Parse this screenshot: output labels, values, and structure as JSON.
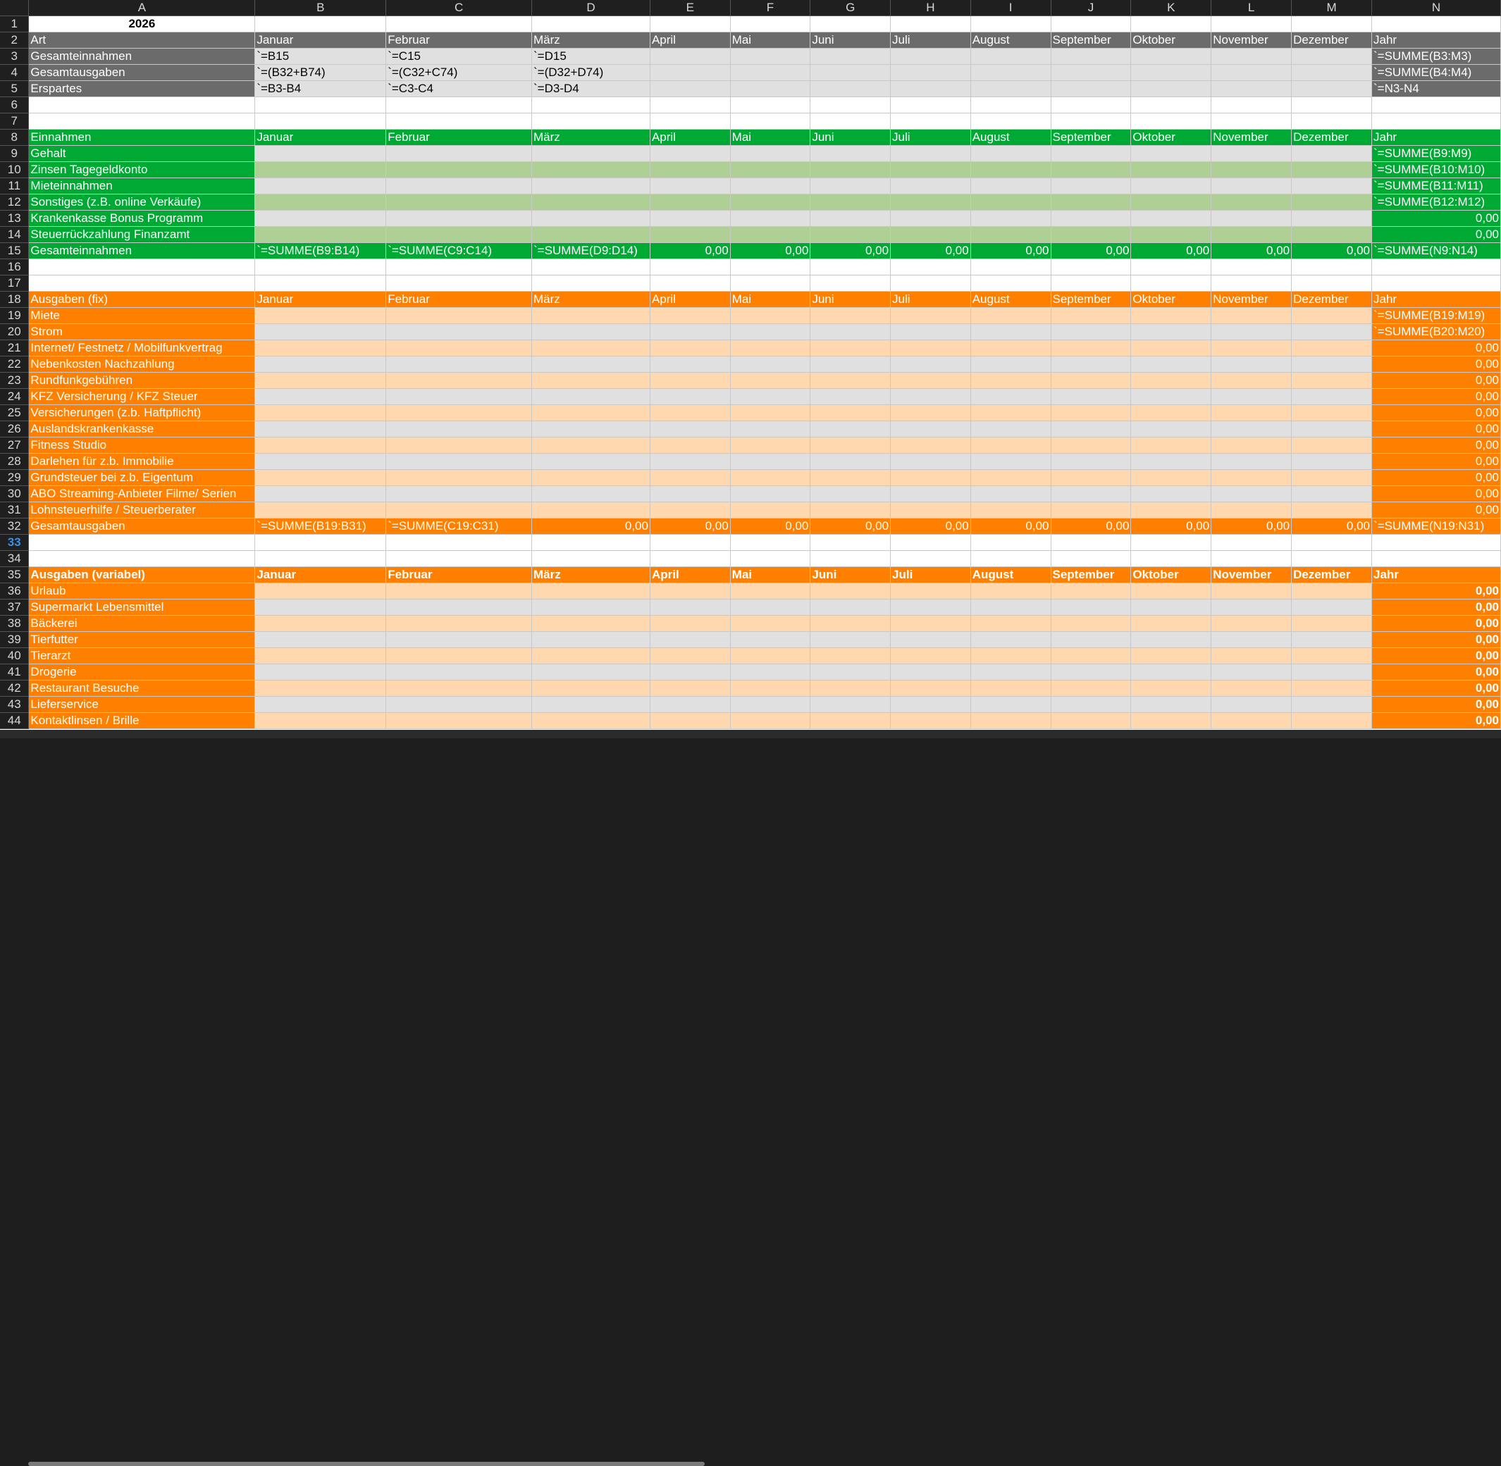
{
  "columns": [
    "A",
    "B",
    "C",
    "D",
    "E",
    "F",
    "G",
    "H",
    "I",
    "J",
    "K",
    "L",
    "M",
    "N"
  ],
  "colors": {
    "gray_dark": "#6b6b6b",
    "gray_light": "#e0e0e0",
    "green": "#00a933",
    "green_light": "#afd095",
    "orange": "#ff8000",
    "orange_light": "#ffd8b0",
    "white": "#ffffff",
    "text_white": "#ffffff",
    "text_dark": "#000000"
  },
  "rows": [
    {
      "n": "1",
      "style": "title",
      "cells": [
        "2026",
        "",
        "",
        "",
        "",
        "",
        "",
        "",
        "",
        "",
        "",
        "",
        "",
        ""
      ]
    },
    {
      "n": "2",
      "style": "gray-header",
      "cells": [
        "Art",
        "Januar",
        "Februar",
        "März",
        "April",
        "Mai",
        "Juni",
        "Juli",
        "August",
        "September",
        "Oktober",
        "November",
        "Dezember",
        "Jahr"
      ]
    },
    {
      "n": "3",
      "style": "gray-row",
      "cells": [
        "Gesamteinnahmen",
        "`=B15",
        "`=C15",
        "`=D15",
        "",
        "",
        "",
        "",
        "",
        "",
        "",
        "",
        "",
        "`=SUMME(B3:M3)"
      ]
    },
    {
      "n": "4",
      "style": "gray-row",
      "cells": [
        "Gesamtausgaben",
        "`=(B32+B74)",
        "`=(C32+C74)",
        "`=(D32+D74)",
        "",
        "",
        "",
        "",
        "",
        "",
        "",
        "",
        "",
        "`=SUMME(B4:M4)"
      ]
    },
    {
      "n": "5",
      "style": "gray-row",
      "cells": [
        "Erspartes",
        "`=B3-B4",
        "`=C3-C4",
        "`=D3-D4",
        "",
        "",
        "",
        "",
        "",
        "",
        "",
        "",
        "",
        "`=N3-N4"
      ]
    },
    {
      "n": "6",
      "style": "empty",
      "cells": [
        "",
        "",
        "",
        "",
        "",
        "",
        "",
        "",
        "",
        "",
        "",
        "",
        "",
        ""
      ]
    },
    {
      "n": "7",
      "style": "empty",
      "cells": [
        "",
        "",
        "",
        "",
        "",
        "",
        "",
        "",
        "",
        "",
        "",
        "",
        "",
        ""
      ]
    },
    {
      "n": "8",
      "style": "green-header",
      "cells": [
        "Einnahmen",
        "Januar",
        "Februar",
        "März",
        "April",
        "Mai",
        "Juni",
        "Juli",
        "August",
        "September",
        "Oktober",
        "November",
        "Dezember",
        "Jahr"
      ]
    },
    {
      "n": "9",
      "style": "green-a",
      "cells": [
        "Gehalt",
        "",
        "",
        "",
        "",
        "",
        "",
        "",
        "",
        "",
        "",
        "",
        "",
        "`=SUMME(B9:M9)"
      ]
    },
    {
      "n": "10",
      "style": "green-b",
      "cells": [
        "Zinsen Tagegeldkonto",
        "",
        "",
        "",
        "",
        "",
        "",
        "",
        "",
        "",
        "",
        "",
        "",
        "`=SUMME(B10:M10)"
      ]
    },
    {
      "n": "11",
      "style": "green-a",
      "cells": [
        "Mieteinnahmen",
        "",
        "",
        "",
        "",
        "",
        "",
        "",
        "",
        "",
        "",
        "",
        "",
        "`=SUMME(B11:M11)"
      ]
    },
    {
      "n": "12",
      "style": "green-b",
      "cells": [
        "Sonstiges (z.B. online Verkäufe)",
        "",
        "",
        "",
        "",
        "",
        "",
        "",
        "",
        "",
        "",
        "",
        "",
        "`=SUMME(B12:M12)"
      ]
    },
    {
      "n": "13",
      "style": "green-a",
      "cells": [
        "Krankenkasse Bonus Programm",
        "",
        "",
        "",
        "",
        "",
        "",
        "",
        "",
        "",
        "",
        "",
        "",
        "0,00"
      ]
    },
    {
      "n": "14",
      "style": "green-b",
      "cells": [
        "Steuerrückzahlung Finanzamt",
        "",
        "",
        "",
        "",
        "",
        "",
        "",
        "",
        "",
        "",
        "",
        "",
        "0,00"
      ]
    },
    {
      "n": "15",
      "style": "green-total",
      "cells": [
        "Gesamteinnahmen",
        "`=SUMME(B9:B14)",
        "`=SUMME(C9:C14)",
        "`=SUMME(D9:D14)",
        "0,00",
        "0,00",
        "0,00",
        "0,00",
        "0,00",
        "0,00",
        "0,00",
        "0,00",
        "0,00",
        "`=SUMME(N9:N14)"
      ]
    },
    {
      "n": "16",
      "style": "empty",
      "cells": [
        "",
        "",
        "",
        "",
        "",
        "",
        "",
        "",
        "",
        "",
        "",
        "",
        "",
        ""
      ]
    },
    {
      "n": "17",
      "style": "empty",
      "cells": [
        "",
        "",
        "",
        "",
        "",
        "",
        "",
        "",
        "",
        "",
        "",
        "",
        "",
        ""
      ]
    },
    {
      "n": "18",
      "style": "orange-header",
      "cells": [
        "Ausgaben (fix)",
        "Januar",
        "Februar",
        "März",
        "April",
        "Mai",
        "Juni",
        "Juli",
        "August",
        "September",
        "Oktober",
        "November",
        "Dezember",
        "Jahr"
      ]
    },
    {
      "n": "19",
      "style": "orange-b",
      "cells": [
        "Miete",
        "",
        "",
        "",
        "",
        "",
        "",
        "",
        "",
        "",
        "",
        "",
        "",
        "`=SUMME(B19:M19)"
      ]
    },
    {
      "n": "20",
      "style": "orange-a",
      "cells": [
        "Strom",
        "",
        "",
        "",
        "",
        "",
        "",
        "",
        "",
        "",
        "",
        "",
        "",
        "`=SUMME(B20:M20)"
      ]
    },
    {
      "n": "21",
      "style": "orange-b",
      "cells": [
        "Internet/ Festnetz / Mobilfunkvertrag",
        "",
        "",
        "",
        "",
        "",
        "",
        "",
        "",
        "",
        "",
        "",
        "",
        "0,00"
      ]
    },
    {
      "n": "22",
      "style": "orange-a",
      "cells": [
        "Nebenkosten Nachzahlung",
        "",
        "",
        "",
        "",
        "",
        "",
        "",
        "",
        "",
        "",
        "",
        "",
        "0,00"
      ]
    },
    {
      "n": "23",
      "style": "orange-b",
      "cells": [
        "Rundfunkgebühren",
        "",
        "",
        "",
        "",
        "",
        "",
        "",
        "",
        "",
        "",
        "",
        "",
        "0,00"
      ]
    },
    {
      "n": "24",
      "style": "orange-a",
      "cells": [
        "KFZ Versicherung / KFZ Steuer",
        "",
        "",
        "",
        "",
        "",
        "",
        "",
        "",
        "",
        "",
        "",
        "",
        "0,00"
      ]
    },
    {
      "n": "25",
      "style": "orange-b",
      "cells": [
        "Versicherungen (z.b. Haftpflicht)",
        "",
        "",
        "",
        "",
        "",
        "",
        "",
        "",
        "",
        "",
        "",
        "",
        "0,00"
      ]
    },
    {
      "n": "26",
      "style": "orange-a",
      "cells": [
        "Auslandskrankenkasse",
        "",
        "",
        "",
        "",
        "",
        "",
        "",
        "",
        "",
        "",
        "",
        "",
        "0,00"
      ]
    },
    {
      "n": "27",
      "style": "orange-b",
      "cells": [
        "Fitness Studio",
        "",
        "",
        "",
        "",
        "",
        "",
        "",
        "",
        "",
        "",
        "",
        "",
        "0,00"
      ]
    },
    {
      "n": "28",
      "style": "orange-a",
      "cells": [
        "Darlehen für z.b. Immobilie",
        "",
        "",
        "",
        "",
        "",
        "",
        "",
        "",
        "",
        "",
        "",
        "",
        "0,00"
      ]
    },
    {
      "n": "29",
      "style": "orange-b",
      "cells": [
        "Grundsteuer bei z.b. Eigentum",
        "",
        "",
        "",
        "",
        "",
        "",
        "",
        "",
        "",
        "",
        "",
        "",
        "0,00"
      ]
    },
    {
      "n": "30",
      "style": "orange-a",
      "cells": [
        "ABO Streaming-Anbieter Filme/ Serien",
        "",
        "",
        "",
        "",
        "",
        "",
        "",
        "",
        "",
        "",
        "",
        "",
        "0,00"
      ]
    },
    {
      "n": "31",
      "style": "orange-b",
      "cells": [
        "Lohnsteuerhilfe / Steuerberater",
        "",
        "",
        "",
        "",
        "",
        "",
        "",
        "",
        "",
        "",
        "",
        "",
        "0,00"
      ]
    },
    {
      "n": "32",
      "style": "orange-total",
      "cells": [
        "Gesamtausgaben",
        "`=SUMME(B19:B31)",
        "`=SUMME(C19:C31)",
        "0,00",
        "0,00",
        "0,00",
        "0,00",
        "0,00",
        "0,00",
        "0,00",
        "0,00",
        "0,00",
        "0,00",
        "`=SUMME(N19:N31)"
      ]
    },
    {
      "n": "33",
      "style": "empty",
      "active": true,
      "cells": [
        "",
        "",
        "",
        "",
        "",
        "",
        "",
        "",
        "",
        "",
        "",
        "",
        "",
        ""
      ]
    },
    {
      "n": "34",
      "style": "empty",
      "cells": [
        "",
        "",
        "",
        "",
        "",
        "",
        "",
        "",
        "",
        "",
        "",
        "",
        "",
        ""
      ]
    },
    {
      "n": "35",
      "style": "orange-header-bold",
      "cells": [
        "Ausgaben (variabel)",
        "Januar",
        "Februar",
        "März",
        "April",
        "Mai",
        "Juni",
        "Juli",
        "August",
        "September",
        "Oktober",
        "November",
        "Dezember",
        "Jahr"
      ]
    },
    {
      "n": "36",
      "style": "orange-b-bold",
      "cells": [
        "Urlaub",
        "",
        "",
        "",
        "",
        "",
        "",
        "",
        "",
        "",
        "",
        "",
        "",
        "0,00"
      ]
    },
    {
      "n": "37",
      "style": "orange-a-bold",
      "cells": [
        "Supermarkt Lebensmittel",
        "",
        "",
        "",
        "",
        "",
        "",
        "",
        "",
        "",
        "",
        "",
        "",
        "0,00"
      ]
    },
    {
      "n": "38",
      "style": "orange-b-bold",
      "cells": [
        "Bäckerei",
        "",
        "",
        "",
        "",
        "",
        "",
        "",
        "",
        "",
        "",
        "",
        "",
        "0,00"
      ]
    },
    {
      "n": "39",
      "style": "orange-a-bold",
      "cells": [
        "Tierfutter",
        "",
        "",
        "",
        "",
        "",
        "",
        "",
        "",
        "",
        "",
        "",
        "",
        "0,00"
      ]
    },
    {
      "n": "40",
      "style": "orange-b-bold",
      "cells": [
        "Tierarzt",
        "",
        "",
        "",
        "",
        "",
        "",
        "",
        "",
        "",
        "",
        "",
        "",
        "0,00"
      ]
    },
    {
      "n": "41",
      "style": "orange-a-bold",
      "cells": [
        "Drogerie",
        "",
        "",
        "",
        "",
        "",
        "",
        "",
        "",
        "",
        "",
        "",
        "",
        "0,00"
      ]
    },
    {
      "n": "42",
      "style": "orange-b-bold",
      "cells": [
        "Restaurant Besuche",
        "",
        "",
        "",
        "",
        "",
        "",
        "",
        "",
        "",
        "",
        "",
        "",
        "0,00"
      ]
    },
    {
      "n": "43",
      "style": "orange-a-bold",
      "cells": [
        "Lieferservice",
        "",
        "",
        "",
        "",
        "",
        "",
        "",
        "",
        "",
        "",
        "",
        "",
        "0,00"
      ]
    },
    {
      "n": "44",
      "style": "orange-b-bold",
      "cells": [
        "Kontaktlinsen / Brille",
        "",
        "",
        "",
        "",
        "",
        "",
        "",
        "",
        "",
        "",
        "",
        "",
        "0,00"
      ]
    }
  ]
}
